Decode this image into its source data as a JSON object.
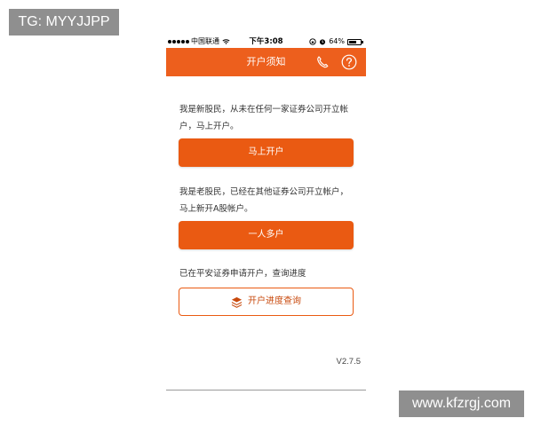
{
  "watermarks": {
    "top_left": "TG: MYYJJPP",
    "bottom_right": "www.kfzrgj.com"
  },
  "status_bar": {
    "carrier": "中国联通",
    "time": "下午3:08",
    "battery": "64%",
    "battery_level": 0.64,
    "icons": [
      "signal-icon",
      "wifi-icon",
      "lock-rotation-icon",
      "alarm-icon",
      "battery-icon"
    ]
  },
  "nav": {
    "title": "开户须知",
    "icons": [
      "phone-icon",
      "help-icon"
    ]
  },
  "sections": {
    "new_investor": {
      "text": "我是新股民，从未在任何一家证券公司开立帐户，马上开户。",
      "button": "马上开户"
    },
    "existing_investor": {
      "text": "我是老股民，已经在其他证券公司开立帐户，马上新开A股帐户。",
      "button": "一人多户"
    },
    "progress": {
      "text": "已在平安证券申请开户，查询进度",
      "button": "开户进度查询",
      "button_icon": "layers-icon"
    }
  },
  "footer": {
    "version": "V2.7.5"
  },
  "colors": {
    "brand_orange": "#ed5f1d",
    "button_orange": "#ea5a12",
    "watermark_bg": "#8f8f8f"
  }
}
